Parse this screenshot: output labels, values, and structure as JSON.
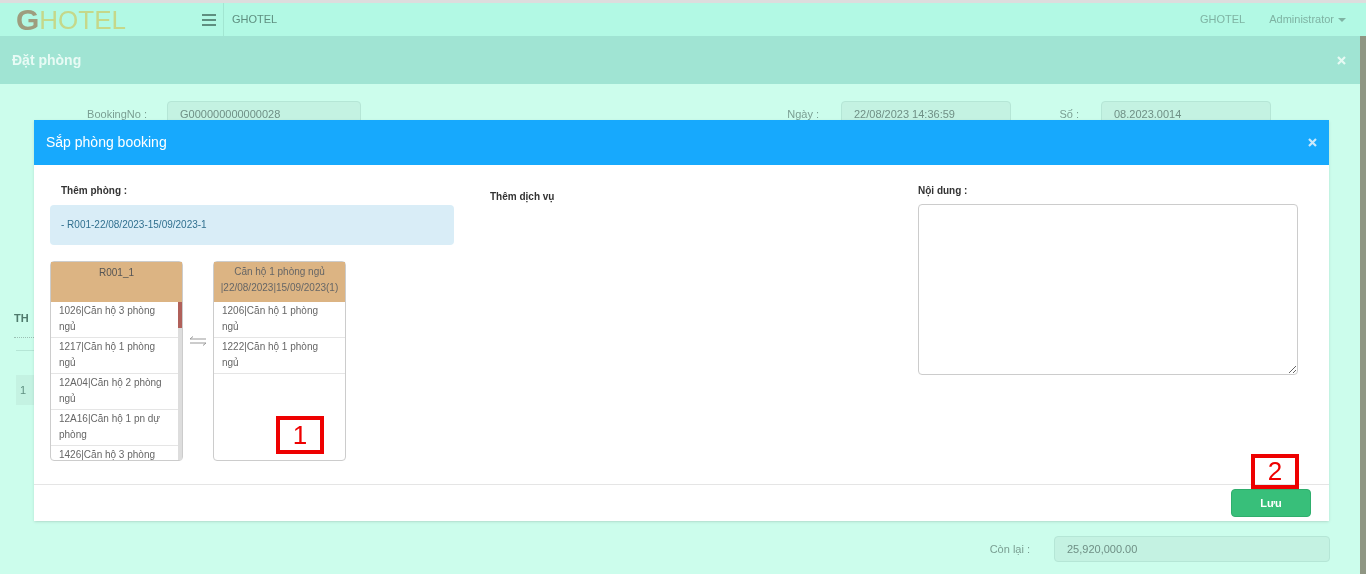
{
  "navbar": {
    "logo_letter": "G",
    "logo_text": "HOTEL",
    "brand": "GHOTEL",
    "right_brand": "GHOTEL",
    "user": "Administrator"
  },
  "page_title": "Đặt phòng",
  "form": {
    "booking_label": "BookingNo :",
    "booking_value": "G000000000000028",
    "date_label": "Ngày :",
    "date_value": "22/08/2023 14:36:59",
    "number_label": "Số :",
    "number_value": "08.2023.0014",
    "section_label": "TH",
    "row_index": "1",
    "remaining_label": "Còn lại :",
    "remaining_value": "25,920,000.00"
  },
  "modal": {
    "title": "Sắp phòng booking",
    "add_room_label": "Thêm phòng :",
    "add_room_entry": "- R001-22/08/2023-15/09/2023-1",
    "add_service_label": "Thêm dịch vụ",
    "content_label": "Nội dung :",
    "source_list": {
      "header": "R001_1",
      "items": [
        "1026|Căn hộ 3 phòng ngủ",
        "1217|Căn hộ 1 phòng ngủ",
        "12A04|Căn hộ 2 phòng ngủ",
        "12A16|Căn hộ 1 pn dự phòng",
        "1426|Căn hộ 3 phòng"
      ]
    },
    "target_list": {
      "header": "Căn hộ 1 phòng ngủ |22/08/2023|15/09/2023(1)",
      "items": [
        "1206|Căn hộ 1 phòng ngủ",
        "1222|Căn hộ 1 phòng ngủ"
      ]
    },
    "save_button": "Lưu"
  },
  "callouts": [
    "1",
    "2"
  ]
}
